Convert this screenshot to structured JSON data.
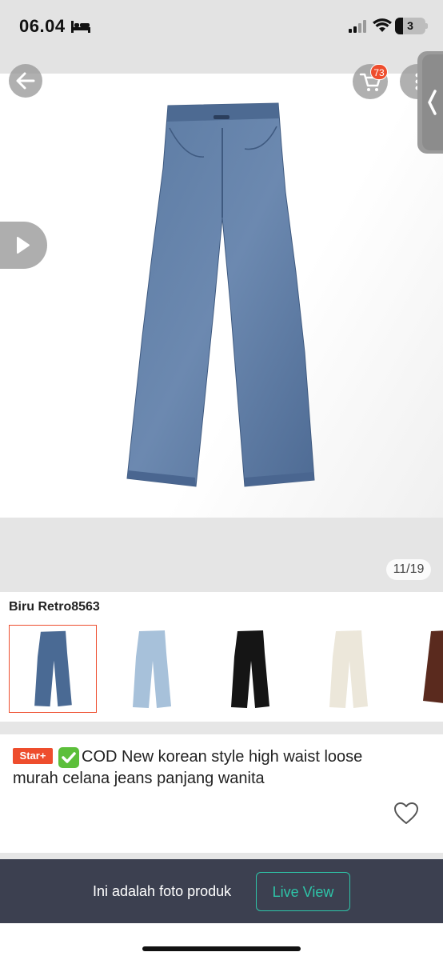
{
  "status_bar": {
    "time": "06.04",
    "battery_level": "3",
    "icons": [
      "bed-icon",
      "signal-icon",
      "wifi-icon",
      "battery-icon"
    ]
  },
  "gallery": {
    "cart_badge": "73",
    "counter": "11/19",
    "icons": [
      "back-arrow-icon",
      "cart-icon",
      "more-icon",
      "chevron-left-icon",
      "play-icon"
    ]
  },
  "variants": {
    "selected_label": "Biru Retro8563",
    "items": [
      {
        "color": "#4a6a94",
        "selected": true
      },
      {
        "color": "#a7c1da",
        "selected": false
      },
      {
        "color": "#151515",
        "selected": false
      },
      {
        "color": "#ece7da",
        "selected": false
      },
      {
        "color": "#5a2a1e",
        "selected": false
      }
    ]
  },
  "product": {
    "badge": "Star+",
    "title_line1": "COD New korean style high waist loose",
    "title_line2": "murah celana jeans panjang wanita",
    "icons": [
      "check-mark-icon",
      "heart-icon"
    ]
  },
  "bottom_bar": {
    "text": "Ini adalah foto produk",
    "button_label": "Live View"
  },
  "colors": {
    "accent": "#ee4d2d",
    "live_view": "#2ec4a8",
    "bottom_bar": "#3c4050"
  }
}
